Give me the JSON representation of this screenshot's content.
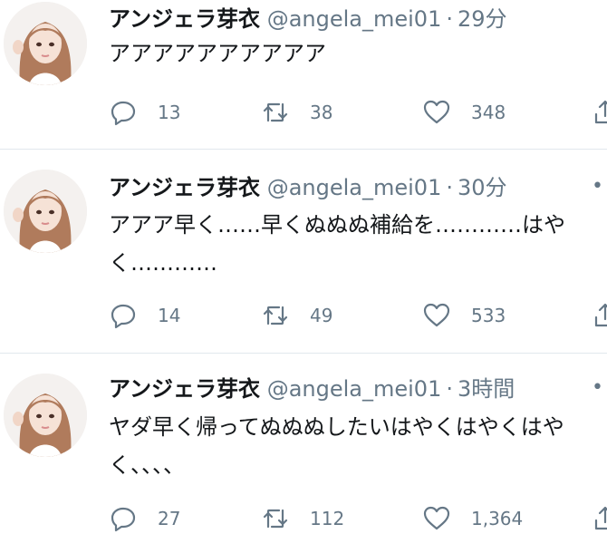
{
  "tweets": [
    {
      "name": "アンジェラ芽衣",
      "handle": "@angela_mei01",
      "separator": "·",
      "time": "29分",
      "text": "アアアアアアアアアア",
      "replies": "13",
      "retweets": "38",
      "likes": "348"
    },
    {
      "name": "アンジェラ芽衣",
      "handle": "@angela_mei01",
      "separator": "·",
      "time": "30分",
      "text": "アアア早く……早くぬぬぬ補給を…………はや\nく…………",
      "replies": "14",
      "retweets": "49",
      "likes": "533"
    },
    {
      "name": "アンジェラ芽衣",
      "handle": "@angela_mei01",
      "separator": "·",
      "time": "3時間",
      "text": "ヤダ早く帰ってぬぬぬしたいはやくはやくはや\nく、、、、",
      "replies": "27",
      "retweets": "112",
      "likes": "1,364"
    }
  ],
  "icons": {
    "avatar": "profile-photo",
    "reply": "reply-icon",
    "retweet": "retweet-icon",
    "like": "heart-icon",
    "share": "share-icon",
    "more": "more-dots-icon"
  },
  "colors": {
    "text": "#14171a",
    "secondary": "#657786",
    "divider": "#e1e8ed"
  }
}
